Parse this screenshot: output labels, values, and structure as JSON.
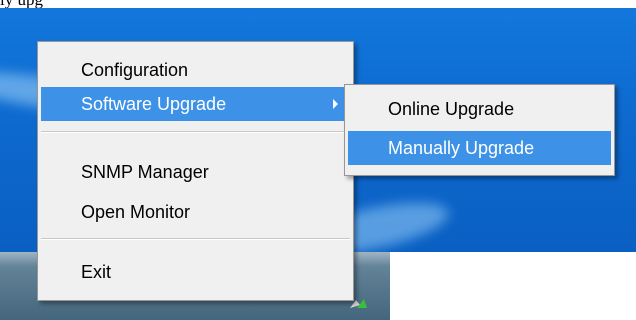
{
  "page_caption": "ly upg",
  "context_menu": {
    "items": [
      {
        "label": "Configuration"
      },
      {
        "label": "Software Upgrade",
        "highlighted": true,
        "has_submenu": true
      },
      {
        "label": "SNMP Manager"
      },
      {
        "label": "Open Monitor"
      },
      {
        "label": "Exit"
      }
    ]
  },
  "submenu": {
    "items": [
      {
        "label": "Online Upgrade"
      },
      {
        "label": "Manually Upgrade",
        "highlighted": true
      }
    ]
  },
  "colors": {
    "menu_background": "#f0f0f0",
    "highlight": "#3d92e8",
    "desktop": "#0e6bd0",
    "taskbar": "#5d7d92"
  },
  "icons": {
    "submenu_arrow": "chevron-right-icon",
    "tray_icon": "tray-app-icon"
  }
}
